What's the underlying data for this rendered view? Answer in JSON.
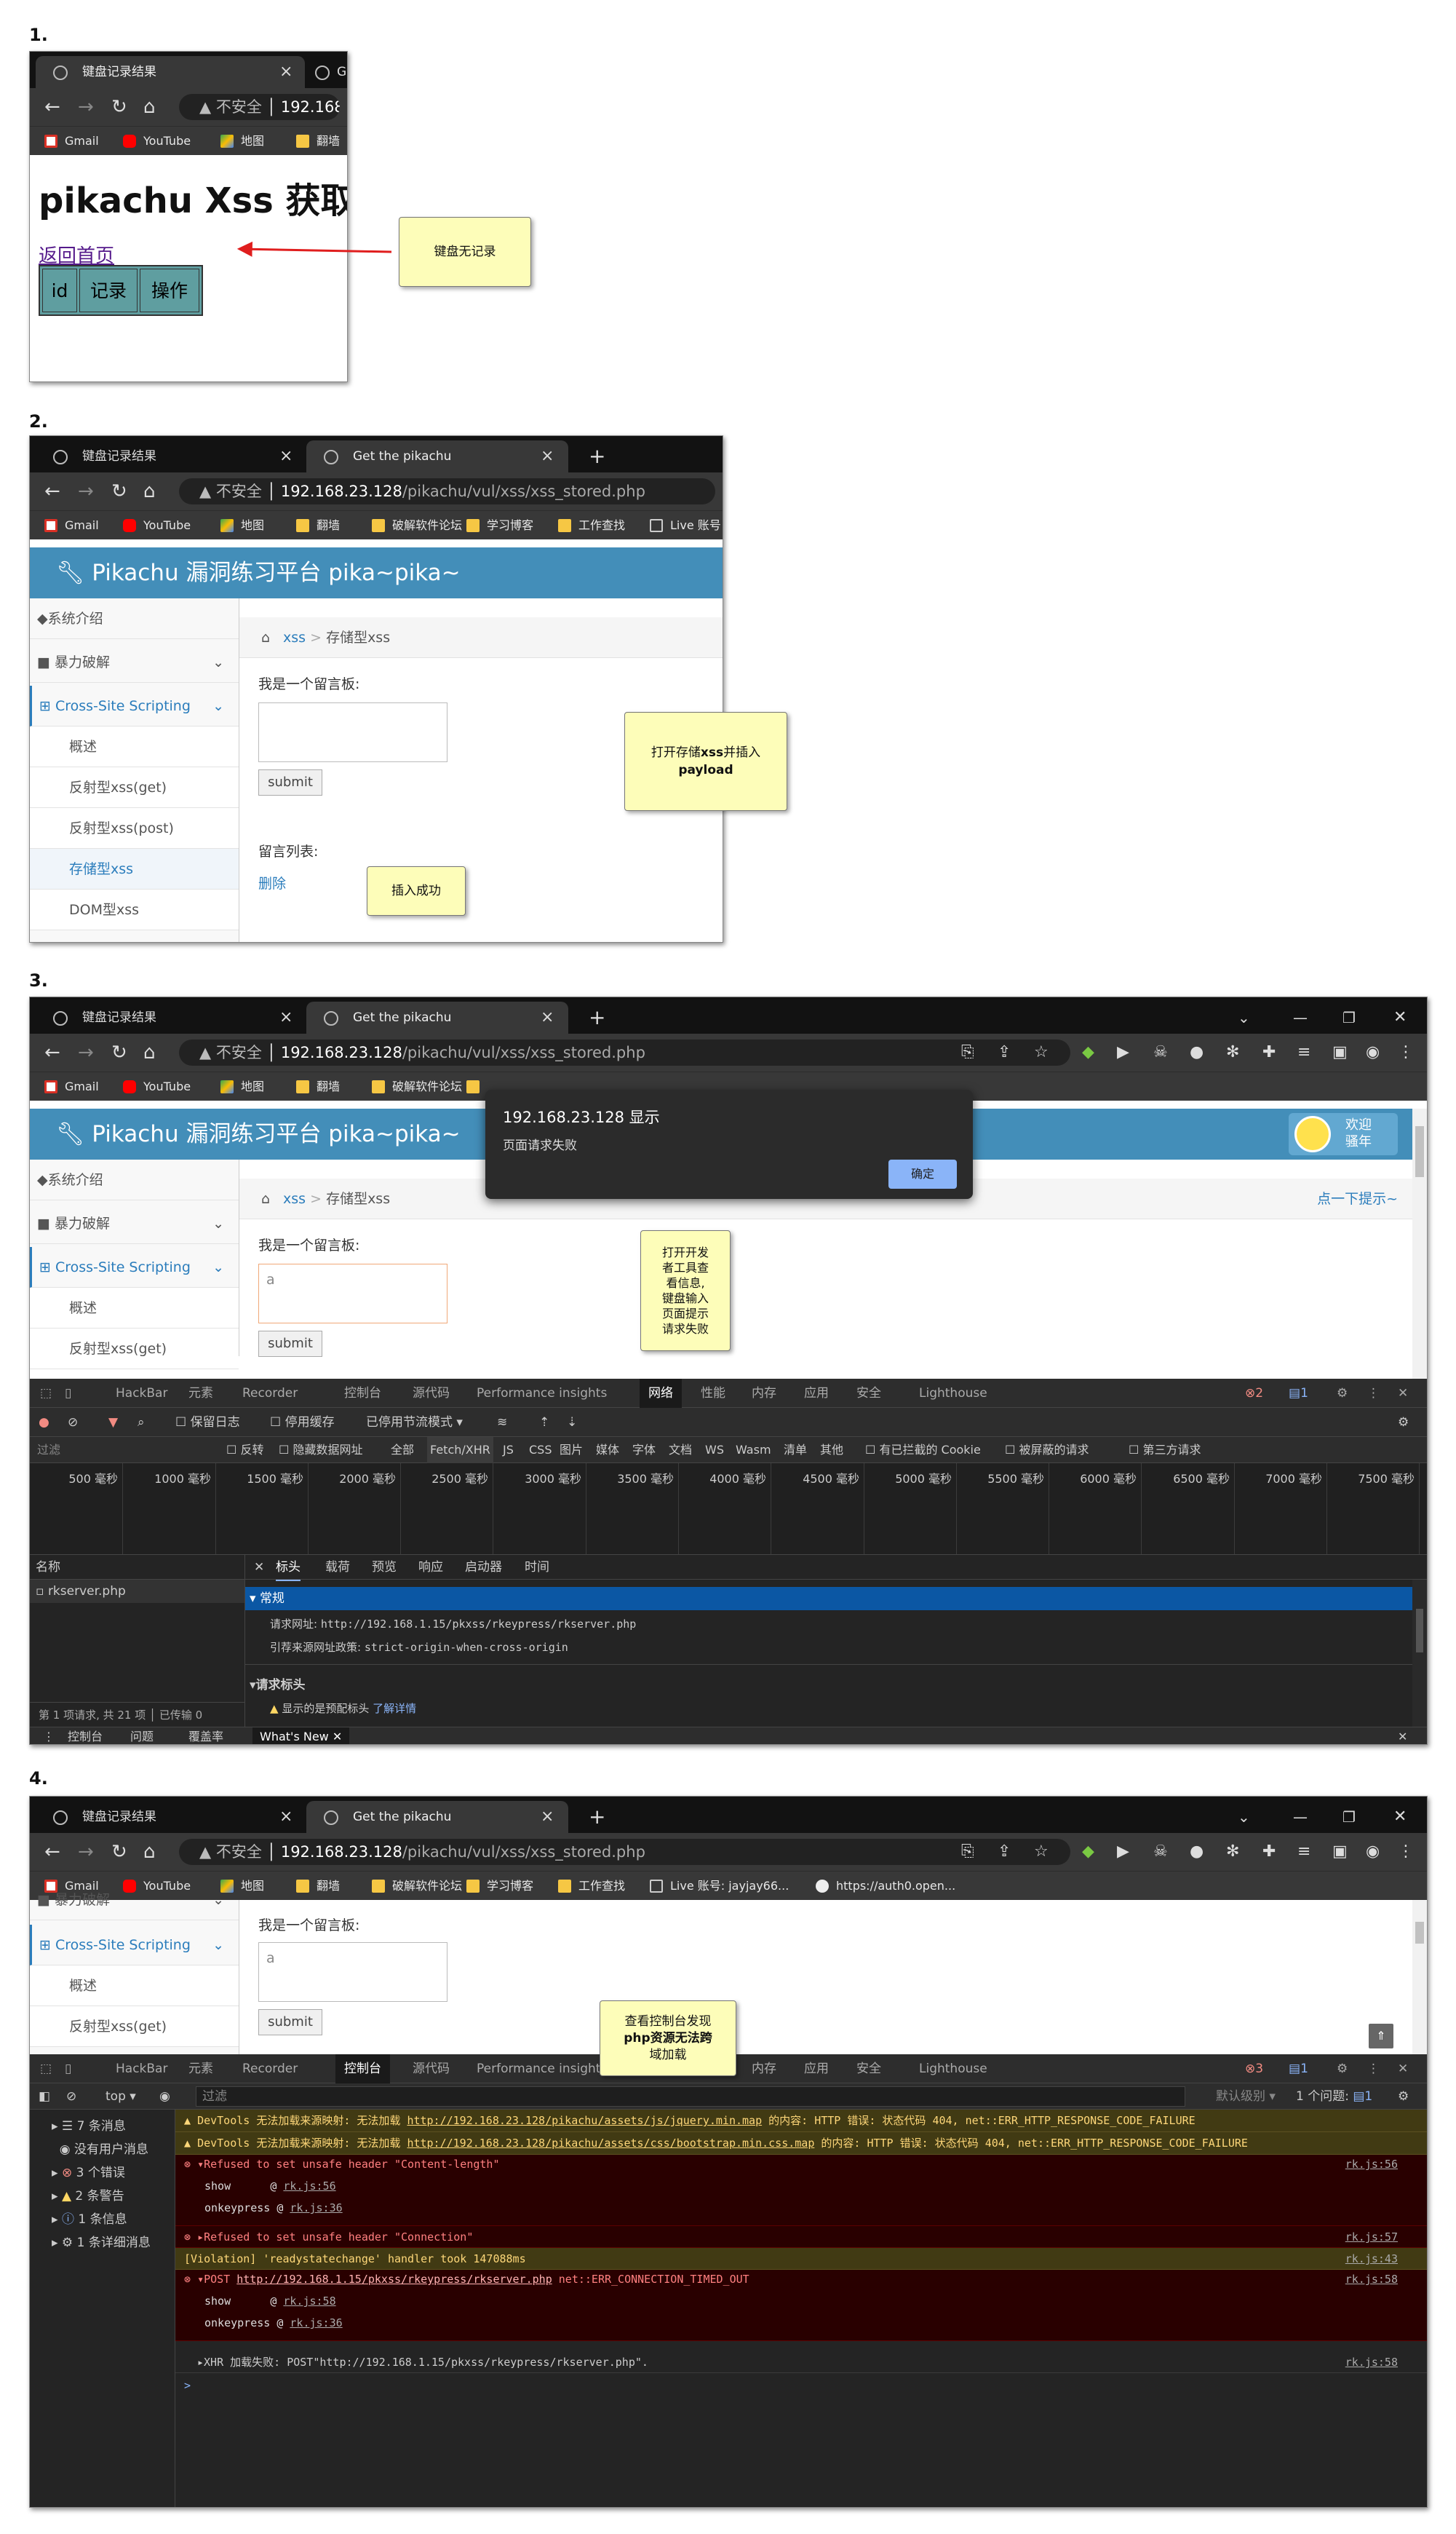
{
  "steps": {
    "s1": "1.",
    "s2": "2.",
    "s3": "3.",
    "s4": "4."
  },
  "browser": {
    "tab1": "键盘记录结果",
    "tab2": "Get the pikachu",
    "tab2_short": "G",
    "new_tab": "+",
    "insecure": "不安全",
    "host": "192.168.23.128",
    "host_short": "192.168.",
    "path": "/pikachu/vul/xss/xss_stored.php",
    "bookmarks": [
      "Gmail",
      "YouTube",
      "地图",
      "翻墙",
      "破解软件论坛",
      "学习博客",
      "工作查找",
      "Live 账号: jayjay66...",
      "https://auth0.open..."
    ],
    "bookmark_live_short": "Live 账号"
  },
  "shot1": {
    "heading": "pikachu Xss 获取键",
    "back_link": "返回首页",
    "table_headers": [
      "id",
      "记录",
      "操作"
    ],
    "callout": "键盘无记录"
  },
  "pikachu": {
    "header": "Pikachu 漏洞练习平台 pika~pika~",
    "side": {
      "intro": "系统介绍",
      "brute": "暴力破解",
      "xss": "Cross-Site Scripting",
      "overview": "概述",
      "reflected_get": "反射型xss(get)",
      "reflected_post": "反射型xss(post)",
      "stored": "存储型xss",
      "dom": "DOM型xss"
    },
    "crumb_xss": "xss",
    "crumb_sep": ">",
    "crumb_page": "存储型xss",
    "board_label": "我是一个留言板:",
    "submit": "submit",
    "list_label": "留言列表:",
    "delete": "删除",
    "hint": "点一下提示~",
    "welcome": "欢迎",
    "welcome2": "骚年",
    "input_val": "a"
  },
  "shot2": {
    "callout1": "打开存储xss并插入payload",
    "callout1_a": "打开存储",
    "callout1_b": "xss",
    "callout1_c": "并插入",
    "callout1_d": "payload",
    "callout2": "插入成功"
  },
  "shot3": {
    "alert_title": "192.168.23.128 显示",
    "alert_msg": "页面请求失败",
    "alert_ok": "确定",
    "callout": "打开开发者工具查看信息,键盘输入页面提示请求失败",
    "callout_lines": [
      "打开开发",
      "者工具查",
      "看信息,",
      "键盘输入",
      "页面提示",
      "请求失败"
    ]
  },
  "devtools": {
    "tabs": [
      "HackBar",
      "元素",
      "Recorder",
      "控制台",
      "源代码",
      "Performance insights",
      "网络",
      "性能",
      "内存",
      "应用",
      "安全",
      "Lighthouse"
    ],
    "badge_err3": "2",
    "badge_msg3": "1",
    "badge_err4": "3",
    "badge_msg4": "1",
    "net_toolbar": [
      "保留日志",
      "停用缓存",
      "已停用节流模式"
    ],
    "filter": "过滤",
    "filter_opts": [
      "反转",
      "隐藏数据网址",
      "全部",
      "Fetch/XHR",
      "JS",
      "CSS",
      "图片",
      "媒体",
      "字体",
      "文档",
      "WS",
      "Wasm",
      "清单",
      "其他",
      "有已拦截的 Cookie",
      "被屏蔽的请求",
      "第三方请求"
    ],
    "timeline": [
      "500 毫秒",
      "1000 毫秒",
      "1500 毫秒",
      "2000 毫秒",
      "2500 毫秒",
      "3000 毫秒",
      "3500 毫秒",
      "4000 毫秒",
      "4500 毫秒",
      "5000 毫秒",
      "5500 毫秒",
      "6000 毫秒",
      "6500 毫秒",
      "7000 毫秒",
      "7500 毫秒"
    ],
    "name_col": "名称",
    "req_name": "rkserver.php",
    "detail_tabs": [
      "标头",
      "载荷",
      "预览",
      "响应",
      "启动器",
      "时间"
    ],
    "general": "常规",
    "req_url_label": "请求网址:",
    "req_url": "http://192.168.1.15/pkxss/rkeypress/rkserver.php",
    "referrer_label": "引荐来源网址政策:",
    "referrer": "strict-origin-when-cross-origin",
    "req_headers": "请求标头",
    "provisional": "显示的是预配标头",
    "learn_more": "了解详情",
    "summary": "第 1 项请求, 共 21 项",
    "transferred": "已传输 0",
    "drawer": [
      "控制台",
      "问题",
      "覆盖率",
      "What's New"
    ]
  },
  "shot4": {
    "callout": "查看控制台发现php资源无法跨域加载",
    "callout_lines": [
      "查看控制台发现",
      "php资源无法跨",
      "域加载"
    ],
    "top": "top",
    "filter": "过滤",
    "levels": "默认级别",
    "issues": "1 个问题:",
    "issues_n": "1",
    "sidebar": [
      "7 条消息",
      "没有用户消息",
      "3 个错误",
      "2 条警告",
      "1 条信息",
      "1 条详细消息"
    ],
    "msgs": [
      {
        "t": "DevTools 无法加载来源映射: 无法加载 ",
        "u": "http://192.168.23.128/pikachu/assets/js/jquery.min.map",
        "t2": " 的内容: HTTP 错误: 状态代码 404, net::ERR_HTTP_RESPONSE_CODE_FAILURE"
      },
      {
        "t": "DevTools 无法加载来源映射: 无法加载 ",
        "u": "http://192.168.23.128/pikachu/assets/css/bootstrap.min.css.map",
        "t2": " 的内容: HTTP 错误: 状态代码 404, net::ERR_HTTP_RESPONSE_CODE_FAILURE"
      }
    ],
    "e1": "▾Refused to set unsafe header \"Content-length\"",
    "e1_ref": "rk.js:56",
    "show": "show",
    "onkeypress": "onkeypress",
    "at": "@",
    "e1_s1": "rk.js:56",
    "e1_s2": "rk.js:36",
    "e2": "▸Refused to set unsafe header \"Connection\"",
    "e2_ref": "rk.js:57",
    "v": "[Violation] 'readystatechange' handler took 147088ms",
    "v_ref": "rk.js:43",
    "e3_pre": "▾POST ",
    "e3_url": "http://192.168.1.15/pkxss/rkeypress/rkserver.php",
    "e3_post": " net::ERR_CONNECTION_TIMED_OUT",
    "e3_ref": "rk.js:58",
    "e3_s1": "rk.js:58",
    "e3_s2": "rk.js:36",
    "xhr": "▸XHR 加载失败: POST\"http://192.168.1.15/pkxss/rkeypress/rkserver.php\".",
    "xhr_ref": "rk.js:58",
    "prompt": ">"
  },
  "colors": {
    "pk_blue": "#438eb9",
    "callout": "#fdfdb9",
    "arrow": "#e01e1e",
    "chrome_dark": "#383838"
  }
}
